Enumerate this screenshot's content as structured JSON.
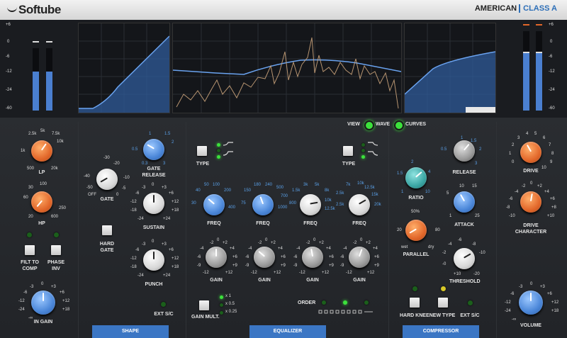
{
  "header": {
    "logo": "Softube",
    "brand_left": "AMERICAN",
    "brand_right": "CLASS A"
  },
  "meters": {
    "left_scale": [
      "+6",
      "0",
      "-6",
      "-12",
      "-24",
      "-60"
    ],
    "right_scale": [
      "+6",
      "0",
      "-6",
      "-12",
      "-24",
      "-60"
    ],
    "left_levels": [
      0.63,
      0.63
    ],
    "right_levels": [
      0.72,
      0.72
    ]
  },
  "view": {
    "label": "VIEW",
    "wave": "WAVE",
    "curves": "CURVES"
  },
  "filters": {
    "lp": {
      "label": "LP",
      "ticks": [
        "2.5k",
        "5k",
        "7.5k",
        "1k",
        "10k",
        "500",
        "20k"
      ]
    },
    "hp": {
      "label": "HP",
      "ticks": [
        "30",
        "100",
        "60",
        "20",
        "250",
        "600"
      ]
    },
    "filt_to_comp": "FILT TO COMP",
    "phase_inv": "PHASE INV",
    "in_gain": {
      "label": "IN GAIN",
      "ticks": [
        "0",
        "-3",
        "+3",
        "-6",
        "+6",
        "-12",
        "+12",
        "-24",
        "+18",
        "-∞"
      ]
    }
  },
  "shape": {
    "gate": {
      "label": "GATE",
      "ticks": [
        "-30",
        "-20",
        "-40",
        "-10",
        "-50",
        "-5",
        "OFF",
        "0"
      ]
    },
    "gate_release": {
      "label": "GATE RELEASE",
      "ticks": [
        "1",
        "1.5",
        "0.5",
        "2",
        "0.3",
        "3"
      ]
    },
    "sustain": {
      "label": "SUSTAIN",
      "ticks": [
        "0",
        "-3",
        "+3",
        "-6",
        "+6",
        "-12",
        "+12",
        "-18",
        "+18",
        "-24",
        "+24"
      ]
    },
    "punch": {
      "label": "PUNCH",
      "ticks": [
        "0",
        "-3",
        "+3",
        "-6",
        "+6",
        "-12",
        "+12",
        "-18",
        "+18",
        "-24",
        "+24"
      ]
    },
    "hard_gate": "HARD GATE",
    "ext_sc": "EXT S/C",
    "tab": "SHAPE"
  },
  "equalizer": {
    "type_left": "TYPE",
    "type_right": "TYPE",
    "bands": [
      {
        "freq_label": "FREQ",
        "ticks": [
          "50",
          "100",
          "40",
          "200",
          "30",
          "400"
        ],
        "gain_label": "GAIN"
      },
      {
        "freq_label": "FREQ",
        "ticks": [
          "180",
          "240",
          "500",
          "150",
          "700",
          "75",
          "1000"
        ],
        "gain_label": "GAIN"
      },
      {
        "freq_label": "FREQ",
        "ticks": [
          "3k",
          "5k",
          "1.5k",
          "8k",
          "800",
          "10k",
          "12.5k"
        ],
        "gain_label": "GAIN"
      },
      {
        "freq_label": "FREQ",
        "ticks": [
          "7k",
          "10k",
          "12.5k",
          "2.5k",
          "15k",
          "2.5k",
          "20k"
        ],
        "gain_label": "GAIN"
      }
    ],
    "gain_ticks": [
      "-2",
      "0",
      "+2",
      "-4",
      "+4",
      "-6",
      "+6",
      "-9",
      "+9",
      "-12",
      "+12"
    ],
    "gain_mult": "GAIN MULT.",
    "mult_options": [
      "x 1",
      "x 0.5",
      "x 0.25"
    ],
    "order": "ORDER",
    "tab": "EQUALIZER"
  },
  "compressor": {
    "ratio": {
      "label": "RATIO",
      "ticks": [
        "2",
        "1.5",
        "4",
        "1",
        "10"
      ]
    },
    "release": {
      "label": "RELEASE",
      "ticks": [
        "1",
        "1.5",
        "0.5",
        "2",
        "3"
      ]
    },
    "attack": {
      "label": "ATTACK",
      "ticks": [
        "10",
        "15",
        "5",
        "1",
        "25"
      ]
    },
    "parallel": {
      "label": "PARALLEL",
      "ticks": [
        "50%",
        "20",
        "80",
        "wet",
        "dry"
      ]
    },
    "threshold": {
      "label": "THRESHOLD",
      "ticks": [
        "-6",
        "-4",
        "-8",
        "-2",
        "-10",
        "-0",
        "+10",
        "-20"
      ]
    },
    "hard_knee": "HARD KNEE",
    "new_type": "NEW TYPE",
    "ext_sc": "EXT S/C",
    "tab": "COMPRESSOR"
  },
  "output": {
    "drive": {
      "label": "DRIVE",
      "ticks": [
        "4",
        "5",
        "3",
        "6",
        "2",
        "7",
        "1",
        "8",
        "0",
        "9",
        "10"
      ]
    },
    "drive_character": {
      "label": "DRIVE CHARACTER",
      "ticks": [
        "-2",
        "0",
        "+2",
        "-4",
        "+4",
        "-6",
        "+6",
        "-8",
        "+8",
        "-10",
        "+10"
      ]
    },
    "volume": {
      "label": "VOLUME",
      "ticks": [
        "0",
        "-3",
        "+3",
        "-6",
        "+6",
        "-12",
        "+12",
        "-24",
        "+18",
        "-∞"
      ]
    }
  },
  "colors": {
    "accent_blue": "#3b76c4",
    "orange": "#e2672a",
    "led_green": "#3ce23c"
  }
}
